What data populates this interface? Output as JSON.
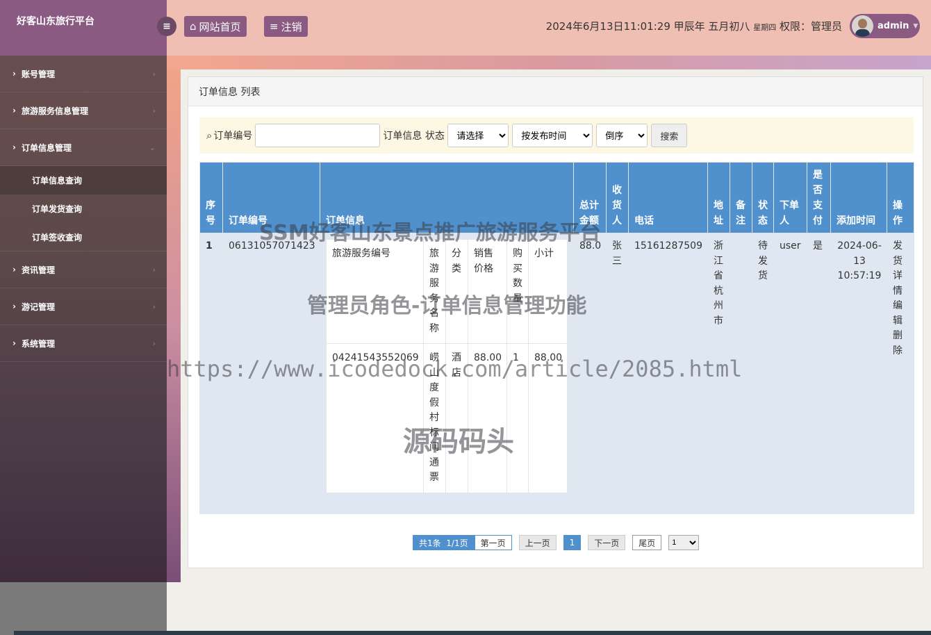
{
  "brand": "好客山东旅行平台",
  "topbar": {
    "home_label": "网站首页",
    "logout_label": "注销",
    "datetime": "2024年6月13日11:01:29 甲辰年 五月初八",
    "weekday": "星期四",
    "role": "权限：管理员",
    "username": "admin"
  },
  "sidebar": {
    "items": [
      {
        "label": "账号管理"
      },
      {
        "label": "旅游服务信息管理"
      },
      {
        "label": "订单信息管理",
        "expanded": true,
        "children": [
          "订单信息查询",
          "订单发货查询",
          "订单签收查询"
        ]
      },
      {
        "label": "资讯管理"
      },
      {
        "label": "游记管理"
      },
      {
        "label": "系统管理"
      }
    ]
  },
  "panel": {
    "title": "订单信息 列表"
  },
  "filter": {
    "order_no_label": "订单编号",
    "order_info_label": "订单信息",
    "status_label": "状态",
    "status_select": "请选择",
    "sort_select": "按发布时间",
    "order_select": "倒序",
    "search_label": "搜索"
  },
  "table": {
    "headers": [
      "序号",
      "订单编号",
      "订单信息",
      "总计金额",
      "收货人",
      "电话",
      "地址",
      "备注",
      "状态",
      "下单人",
      "是否支付",
      "添加时间",
      "操作"
    ],
    "rows": [
      {
        "index": "1",
        "order_no": "06131057071423",
        "total": "88.0",
        "receiver": "张三",
        "phone": "15161287509",
        "address": "浙江省杭州市",
        "remark": "",
        "status": "待发货",
        "orderer": "user",
        "paid": "是",
        "added": "2024-06-13 10:57:19",
        "actions": [
          "发货",
          "详情",
          "编辑",
          "删除"
        ]
      }
    ],
    "inner_headers": [
      "旅游服务编号",
      "旅游服务名称",
      "分类",
      "销售价格",
      "购买数量",
      "小计"
    ],
    "inner_row": [
      "04241543552069",
      "崂山度假村标间通票",
      "酒店",
      "88.00",
      "1",
      "88.00"
    ]
  },
  "pager": {
    "summary": "共1条  1/1页",
    "first": "第一页",
    "prev": "上一页",
    "current": "1",
    "next": "下一页",
    "last": "尾页",
    "select": "1"
  },
  "watermarks": [
    "SSM好客山东景点推广旅游服务平台",
    "管理员角色-订单信息管理功能",
    "https://www.icodedock.com/article/2085.html",
    "源码码头"
  ]
}
